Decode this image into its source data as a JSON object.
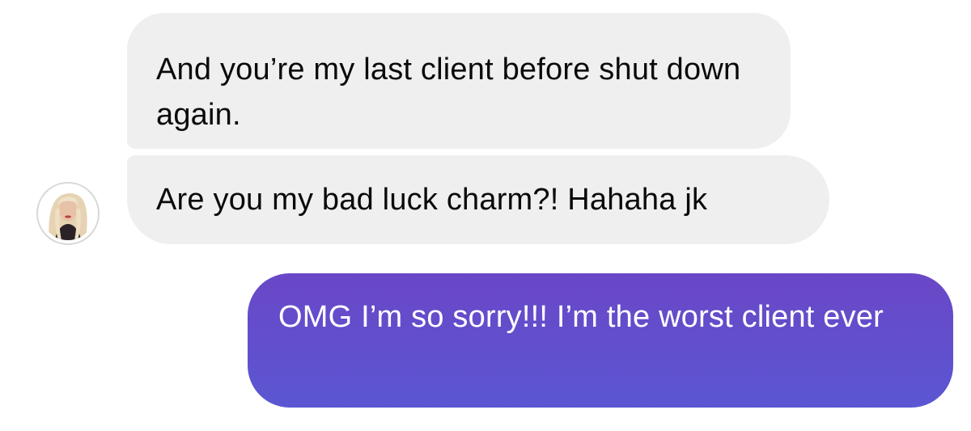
{
  "messages": [
    {
      "direction": "incoming",
      "text": "And you’re my last client before shut down again."
    },
    {
      "direction": "incoming",
      "text": "Are you my bad luck charm?! Hahaha jk"
    },
    {
      "direction": "outgoing",
      "text": "OMG I’m so sorry!!! I’m the worst client ever"
    }
  ],
  "colors": {
    "incoming_bubble": "#efefef",
    "outgoing_bubble": "#6a47c7",
    "background": "#ffffff"
  },
  "avatar": {
    "icon": "contact-avatar-icon"
  }
}
